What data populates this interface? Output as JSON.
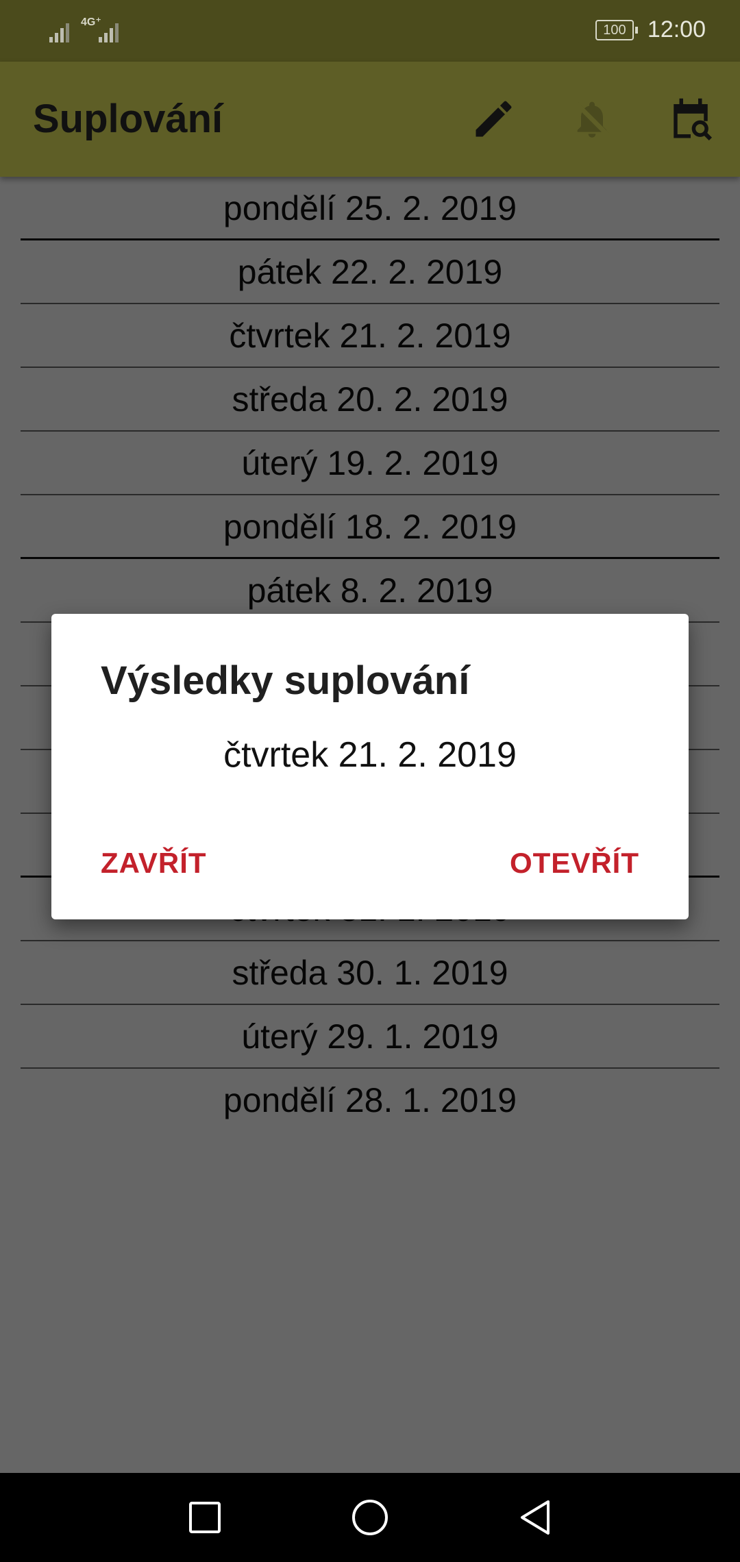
{
  "status_bar": {
    "network_label": "4G⁺",
    "battery_level": "100",
    "time": "12:00"
  },
  "app_bar": {
    "title": "Suplování",
    "actions": [
      "edit-icon",
      "notifications-off-icon",
      "calendar-search-icon"
    ]
  },
  "list": {
    "items": [
      {
        "label": "pondělí 25. 2. 2019",
        "week_break": true
      },
      {
        "label": "pátek 22. 2. 2019",
        "week_break": false
      },
      {
        "label": "čtvrtek 21. 2. 2019",
        "week_break": false
      },
      {
        "label": "středa 20. 2. 2019",
        "week_break": false
      },
      {
        "label": "úterý 19. 2. 2019",
        "week_break": false
      },
      {
        "label": "pondělí 18. 2. 2019",
        "week_break": true
      },
      {
        "label": "pátek 8. 2. 2019",
        "week_break": false
      },
      {
        "label": "",
        "week_break": false
      },
      {
        "label": "",
        "week_break": false
      },
      {
        "label": "",
        "week_break": false
      },
      {
        "label": "",
        "week_break": true
      },
      {
        "label": "čtvrtek 31. 1. 2019",
        "week_break": false
      },
      {
        "label": "středa 30. 1. 2019",
        "week_break": false
      },
      {
        "label": "úterý 29. 1. 2019",
        "week_break": false
      },
      {
        "label": "pondělí 28. 1. 2019",
        "week_break": false
      }
    ]
  },
  "dialog": {
    "title": "Výsledky suplování",
    "message": "čtvrtek 21. 2. 2019",
    "negative_button": "ZAVŘÍT",
    "positive_button": "OTEVŘÍT"
  },
  "colors": {
    "status_bar": "#4b4b1c",
    "app_bar": "#5e5e26",
    "accent": "#c3212b"
  }
}
